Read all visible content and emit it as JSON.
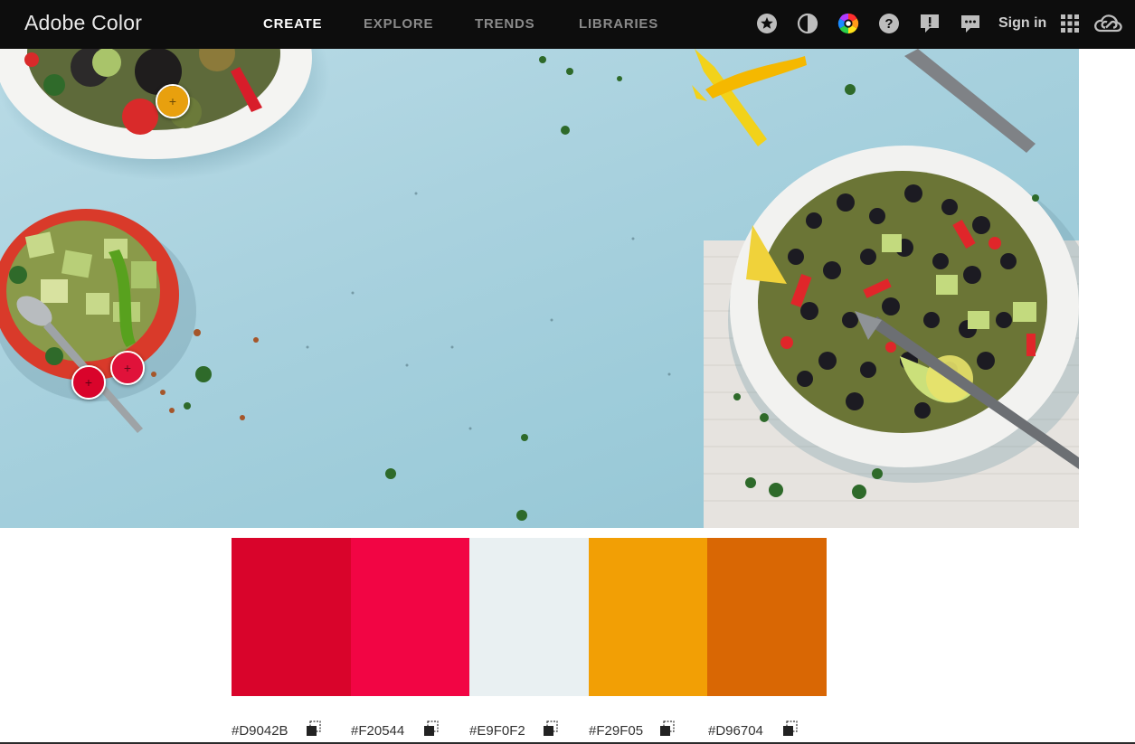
{
  "app": {
    "title": "Adobe Color"
  },
  "nav": {
    "items": [
      {
        "label": "CREATE",
        "active": true
      },
      {
        "label": "EXPLORE",
        "active": false
      },
      {
        "label": "TRENDS",
        "active": false
      },
      {
        "label": "LIBRARIES",
        "active": false
      }
    ]
  },
  "header_icons": [
    "star-icon",
    "contrast-icon",
    "color-wheel-icon",
    "help-icon",
    "feedback-icon",
    "chat-icon",
    "apps-grid-icon",
    "creative-cloud-icon"
  ],
  "header": {
    "sign_in": "Sign in"
  },
  "photo": {
    "alt_subject": "food bowls on light blue table"
  },
  "pickers": [
    {
      "color": "#E8A00E"
    },
    {
      "color": "#D9042B"
    },
    {
      "color": "#E0123A"
    }
  ],
  "palette": {
    "swatches": [
      {
        "hex": "#D9042B",
        "label": "#D9042B"
      },
      {
        "hex": "#F20544",
        "label": "#F20544"
      },
      {
        "hex": "#E9F0F2",
        "label": "#E9F0F2"
      },
      {
        "hex": "#F29F05",
        "label": "#F29F05"
      },
      {
        "hex": "#D96704",
        "label": "#D96704"
      }
    ]
  }
}
